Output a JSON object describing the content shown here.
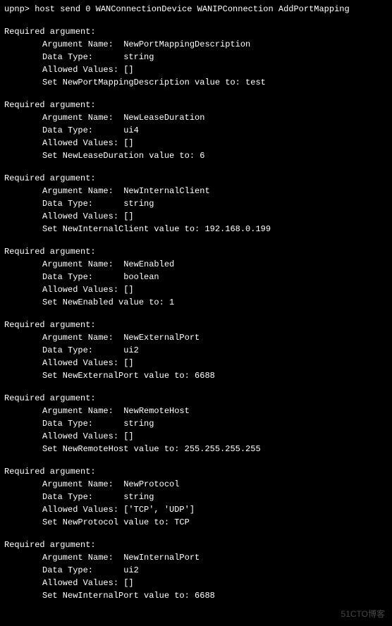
{
  "prompt": "upnp> host send 0 WANConnectionDevice WANIPConnection AddPortMapping",
  "header_label": "Required argument:",
  "labels": {
    "arg_name": "Argument Name:",
    "data_type": "Data Type:",
    "allowed": "Allowed Values:"
  },
  "args": [
    {
      "name": "NewPortMappingDescription",
      "type": "string",
      "allowed": "[]",
      "set_line": "Set NewPortMappingDescription value to: test"
    },
    {
      "name": "NewLeaseDuration",
      "type": "ui4",
      "allowed": "[]",
      "set_line": "Set NewLeaseDuration value to: 6"
    },
    {
      "name": "NewInternalClient",
      "type": "string",
      "allowed": "[]",
      "set_line": "Set NewInternalClient value to: 192.168.0.199"
    },
    {
      "name": "NewEnabled",
      "type": "boolean",
      "allowed": "[]",
      "set_line": "Set NewEnabled value to: 1"
    },
    {
      "name": "NewExternalPort",
      "type": "ui2",
      "allowed": "[]",
      "set_line": "Set NewExternalPort value to: 6688"
    },
    {
      "name": "NewRemoteHost",
      "type": "string",
      "allowed": "[]",
      "set_line": "Set NewRemoteHost value to: 255.255.255.255"
    },
    {
      "name": "NewProtocol",
      "type": "string",
      "allowed": "['TCP', 'UDP']",
      "set_line": "Set NewProtocol value to: TCP"
    },
    {
      "name": "NewInternalPort",
      "type": "ui2",
      "allowed": "[]",
      "set_line": "Set NewInternalPort value to: 6688"
    }
  ],
  "watermark": "51CTO博客"
}
